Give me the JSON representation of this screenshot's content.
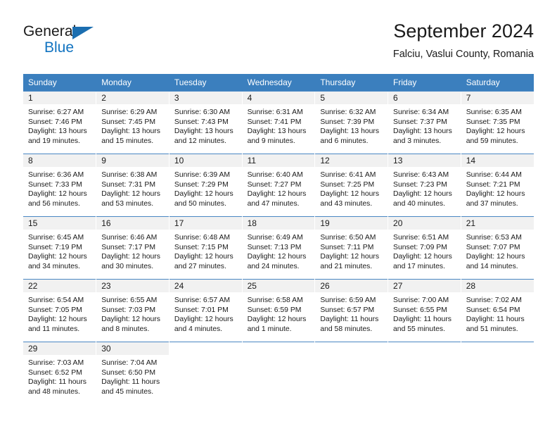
{
  "brand": {
    "line1": "General",
    "line2": "Blue",
    "triangle_color": "#1b6eb0",
    "blue_text_color": "#1173c0",
    "logo_name": "general-blue-logo"
  },
  "header": {
    "month_title": "September 2024",
    "location": "Falciu, Vaslui County, Romania"
  },
  "theme": {
    "header_blue": "#3b7fbe",
    "row_rule_blue": "#4a87c3",
    "date_band_gray": "#f1f1f1",
    "text_color": "#1a1a1a"
  },
  "weekday_headers": [
    "Sunday",
    "Monday",
    "Tuesday",
    "Wednesday",
    "Thursday",
    "Friday",
    "Saturday"
  ],
  "weeks": [
    [
      {
        "date": "1",
        "sunrise": "Sunrise: 6:27 AM",
        "sunset": "Sunset: 7:46 PM",
        "daylight_1": "Daylight: 13 hours",
        "daylight_2": "and 19 minutes."
      },
      {
        "date": "2",
        "sunrise": "Sunrise: 6:29 AM",
        "sunset": "Sunset: 7:45 PM",
        "daylight_1": "Daylight: 13 hours",
        "daylight_2": "and 15 minutes."
      },
      {
        "date": "3",
        "sunrise": "Sunrise: 6:30 AM",
        "sunset": "Sunset: 7:43 PM",
        "daylight_1": "Daylight: 13 hours",
        "daylight_2": "and 12 minutes."
      },
      {
        "date": "4",
        "sunrise": "Sunrise: 6:31 AM",
        "sunset": "Sunset: 7:41 PM",
        "daylight_1": "Daylight: 13 hours",
        "daylight_2": "and 9 minutes."
      },
      {
        "date": "5",
        "sunrise": "Sunrise: 6:32 AM",
        "sunset": "Sunset: 7:39 PM",
        "daylight_1": "Daylight: 13 hours",
        "daylight_2": "and 6 minutes."
      },
      {
        "date": "6",
        "sunrise": "Sunrise: 6:34 AM",
        "sunset": "Sunset: 7:37 PM",
        "daylight_1": "Daylight: 13 hours",
        "daylight_2": "and 3 minutes."
      },
      {
        "date": "7",
        "sunrise": "Sunrise: 6:35 AM",
        "sunset": "Sunset: 7:35 PM",
        "daylight_1": "Daylight: 12 hours",
        "daylight_2": "and 59 minutes."
      }
    ],
    [
      {
        "date": "8",
        "sunrise": "Sunrise: 6:36 AM",
        "sunset": "Sunset: 7:33 PM",
        "daylight_1": "Daylight: 12 hours",
        "daylight_2": "and 56 minutes."
      },
      {
        "date": "9",
        "sunrise": "Sunrise: 6:38 AM",
        "sunset": "Sunset: 7:31 PM",
        "daylight_1": "Daylight: 12 hours",
        "daylight_2": "and 53 minutes."
      },
      {
        "date": "10",
        "sunrise": "Sunrise: 6:39 AM",
        "sunset": "Sunset: 7:29 PM",
        "daylight_1": "Daylight: 12 hours",
        "daylight_2": "and 50 minutes."
      },
      {
        "date": "11",
        "sunrise": "Sunrise: 6:40 AM",
        "sunset": "Sunset: 7:27 PM",
        "daylight_1": "Daylight: 12 hours",
        "daylight_2": "and 47 minutes."
      },
      {
        "date": "12",
        "sunrise": "Sunrise: 6:41 AM",
        "sunset": "Sunset: 7:25 PM",
        "daylight_1": "Daylight: 12 hours",
        "daylight_2": "and 43 minutes."
      },
      {
        "date": "13",
        "sunrise": "Sunrise: 6:43 AM",
        "sunset": "Sunset: 7:23 PM",
        "daylight_1": "Daylight: 12 hours",
        "daylight_2": "and 40 minutes."
      },
      {
        "date": "14",
        "sunrise": "Sunrise: 6:44 AM",
        "sunset": "Sunset: 7:21 PM",
        "daylight_1": "Daylight: 12 hours",
        "daylight_2": "and 37 minutes."
      }
    ],
    [
      {
        "date": "15",
        "sunrise": "Sunrise: 6:45 AM",
        "sunset": "Sunset: 7:19 PM",
        "daylight_1": "Daylight: 12 hours",
        "daylight_2": "and 34 minutes."
      },
      {
        "date": "16",
        "sunrise": "Sunrise: 6:46 AM",
        "sunset": "Sunset: 7:17 PM",
        "daylight_1": "Daylight: 12 hours",
        "daylight_2": "and 30 minutes."
      },
      {
        "date": "17",
        "sunrise": "Sunrise: 6:48 AM",
        "sunset": "Sunset: 7:15 PM",
        "daylight_1": "Daylight: 12 hours",
        "daylight_2": "and 27 minutes."
      },
      {
        "date": "18",
        "sunrise": "Sunrise: 6:49 AM",
        "sunset": "Sunset: 7:13 PM",
        "daylight_1": "Daylight: 12 hours",
        "daylight_2": "and 24 minutes."
      },
      {
        "date": "19",
        "sunrise": "Sunrise: 6:50 AM",
        "sunset": "Sunset: 7:11 PM",
        "daylight_1": "Daylight: 12 hours",
        "daylight_2": "and 21 minutes."
      },
      {
        "date": "20",
        "sunrise": "Sunrise: 6:51 AM",
        "sunset": "Sunset: 7:09 PM",
        "daylight_1": "Daylight: 12 hours",
        "daylight_2": "and 17 minutes."
      },
      {
        "date": "21",
        "sunrise": "Sunrise: 6:53 AM",
        "sunset": "Sunset: 7:07 PM",
        "daylight_1": "Daylight: 12 hours",
        "daylight_2": "and 14 minutes."
      }
    ],
    [
      {
        "date": "22",
        "sunrise": "Sunrise: 6:54 AM",
        "sunset": "Sunset: 7:05 PM",
        "daylight_1": "Daylight: 12 hours",
        "daylight_2": "and 11 minutes."
      },
      {
        "date": "23",
        "sunrise": "Sunrise: 6:55 AM",
        "sunset": "Sunset: 7:03 PM",
        "daylight_1": "Daylight: 12 hours",
        "daylight_2": "and 8 minutes."
      },
      {
        "date": "24",
        "sunrise": "Sunrise: 6:57 AM",
        "sunset": "Sunset: 7:01 PM",
        "daylight_1": "Daylight: 12 hours",
        "daylight_2": "and 4 minutes."
      },
      {
        "date": "25",
        "sunrise": "Sunrise: 6:58 AM",
        "sunset": "Sunset: 6:59 PM",
        "daylight_1": "Daylight: 12 hours",
        "daylight_2": "and 1 minute."
      },
      {
        "date": "26",
        "sunrise": "Sunrise: 6:59 AM",
        "sunset": "Sunset: 6:57 PM",
        "daylight_1": "Daylight: 11 hours",
        "daylight_2": "and 58 minutes."
      },
      {
        "date": "27",
        "sunrise": "Sunrise: 7:00 AM",
        "sunset": "Sunset: 6:55 PM",
        "daylight_1": "Daylight: 11 hours",
        "daylight_2": "and 55 minutes."
      },
      {
        "date": "28",
        "sunrise": "Sunrise: 7:02 AM",
        "sunset": "Sunset: 6:54 PM",
        "daylight_1": "Daylight: 11 hours",
        "daylight_2": "and 51 minutes."
      }
    ],
    [
      {
        "date": "29",
        "sunrise": "Sunrise: 7:03 AM",
        "sunset": "Sunset: 6:52 PM",
        "daylight_1": "Daylight: 11 hours",
        "daylight_2": "and 48 minutes."
      },
      {
        "date": "30",
        "sunrise": "Sunrise: 7:04 AM",
        "sunset": "Sunset: 6:50 PM",
        "daylight_1": "Daylight: 11 hours",
        "daylight_2": "and 45 minutes."
      },
      {
        "date": "",
        "sunrise": "",
        "sunset": "",
        "daylight_1": "",
        "daylight_2": ""
      },
      {
        "date": "",
        "sunrise": "",
        "sunset": "",
        "daylight_1": "",
        "daylight_2": ""
      },
      {
        "date": "",
        "sunrise": "",
        "sunset": "",
        "daylight_1": "",
        "daylight_2": ""
      },
      {
        "date": "",
        "sunrise": "",
        "sunset": "",
        "daylight_1": "",
        "daylight_2": ""
      },
      {
        "date": "",
        "sunrise": "",
        "sunset": "",
        "daylight_1": "",
        "daylight_2": ""
      }
    ]
  ]
}
